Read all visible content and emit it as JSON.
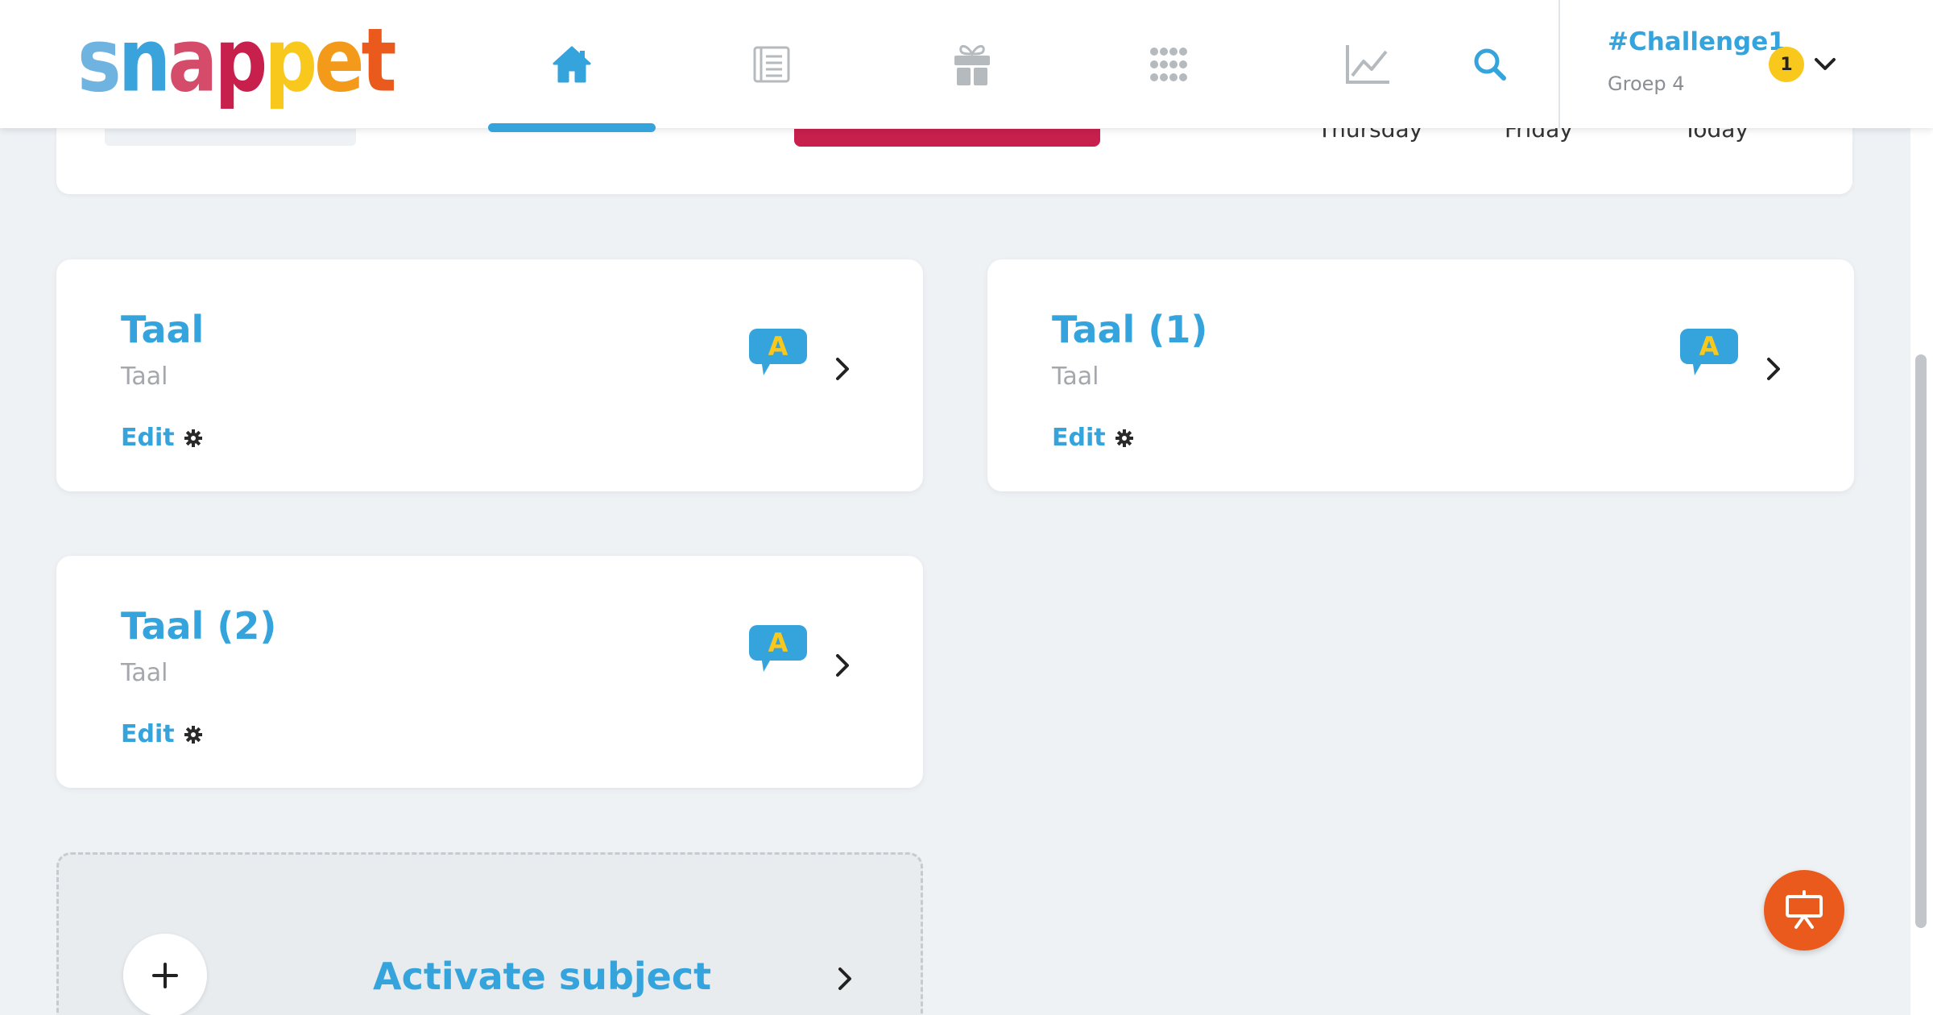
{
  "app": {
    "logo_text": "snappet",
    "logo_letters": [
      {
        "ch": "s",
        "color": "#6fb3e0"
      },
      {
        "ch": "n",
        "color": "#3aa3dc"
      },
      {
        "ch": "a",
        "color": "#d54b6a"
      },
      {
        "ch": "p",
        "color": "#c8204d"
      },
      {
        "ch": "p",
        "color": "#f8c81c"
      },
      {
        "ch": "e",
        "color": "#f39a1b"
      },
      {
        "ch": "t",
        "color": "#ea5a1d"
      }
    ]
  },
  "nav": {
    "items": [
      {
        "name": "home-icon",
        "active": true
      },
      {
        "name": "notebook-icon",
        "active": false
      },
      {
        "name": "gift-icon",
        "active": false
      },
      {
        "name": "apps-grid-icon",
        "active": false
      },
      {
        "name": "chart-icon",
        "active": false
      },
      {
        "name": "search-icon",
        "active": false
      }
    ]
  },
  "group": {
    "name": "#Challenge1",
    "subtitle": "Groep 4",
    "badge": "1"
  },
  "top_card": {
    "days": [
      "Thursday",
      "Friday",
      "Today"
    ]
  },
  "cards": [
    {
      "title": "Taal",
      "subtitle": "Taal",
      "edit_label": "Edit",
      "level": "A"
    },
    {
      "title": "Taal (1)",
      "subtitle": "Taal",
      "edit_label": "Edit",
      "level": "A"
    },
    {
      "title": "Taal (2)",
      "subtitle": "Taal",
      "edit_label": "Edit",
      "level": "A"
    }
  ],
  "activate": {
    "label": "Activate subject"
  },
  "colors": {
    "accent": "#35a4dc",
    "badge": "#f8c81c",
    "fab": "#ea5a1d",
    "red_bar": "#c8204d",
    "background": "#eef2f5"
  }
}
